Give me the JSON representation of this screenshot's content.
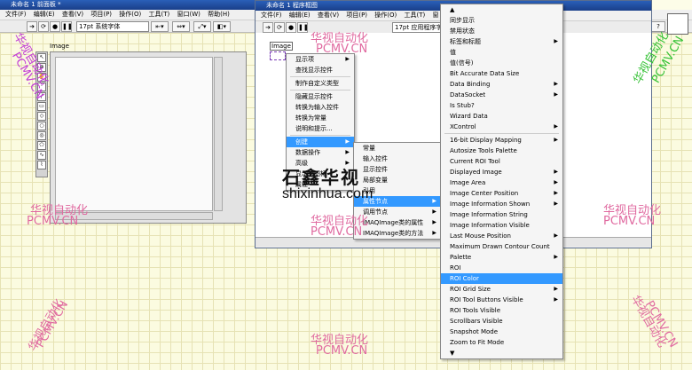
{
  "front_panel": {
    "title": "未命名 1 前面板 *",
    "menu": [
      "文件(F)",
      "编辑(E)",
      "查看(V)",
      "项目(P)",
      "操作(O)",
      "工具(T)",
      "窗口(W)",
      "帮助(H)"
    ],
    "font_dropdown": "17pt 系统字体",
    "image_label": "Image"
  },
  "block_diagram": {
    "title": "未命名 1 程序框图",
    "menu": [
      "文件(F)",
      "编辑(E)",
      "查看(V)",
      "项目(P)",
      "操作(O)",
      "工具(T)",
      "窗"
    ],
    "font_dropdown": "17pt 应用程序字",
    "node_label": "Image"
  },
  "context_menu": {
    "items": [
      {
        "label": "显示项",
        "arrow": true
      },
      {
        "label": "查找显示控件",
        "arrow": false
      },
      {
        "sep": true
      },
      {
        "label": "制作自定义类型",
        "arrow": false
      },
      {
        "sep": true
      },
      {
        "label": "隐藏显示控件",
        "arrow": false
      },
      {
        "label": "转换为输入控件",
        "arrow": false
      },
      {
        "label": "转换为常量",
        "arrow": false
      },
      {
        "label": "说明和提示...",
        "arrow": false
      },
      {
        "sep": true
      },
      {
        "label": "创建",
        "arrow": true,
        "highlight": true
      },
      {
        "label": "数据操作",
        "arrow": true
      },
      {
        "label": "高级",
        "arrow": true
      },
      {
        "label": "显示为图标",
        "arrow": false
      },
      {
        "label": "属性",
        "arrow": false
      }
    ]
  },
  "create_submenu": {
    "items": [
      {
        "label": "常量",
        "arrow": false
      },
      {
        "label": "输入控件",
        "arrow": false
      },
      {
        "label": "显示控件",
        "arrow": false
      },
      {
        "label": "局部变量",
        "arrow": false
      },
      {
        "label": "引用",
        "arrow": false
      },
      {
        "label": "属性节点",
        "arrow": true,
        "highlight": true
      },
      {
        "label": "调用节点",
        "arrow": true
      },
      {
        "label": "IMAQImage类的属性",
        "arrow": true
      },
      {
        "label": "IMAQImage类的方法",
        "arrow": true
      }
    ]
  },
  "property_menu": {
    "items": [
      {
        "label": "▲",
        "arrow": false
      },
      {
        "label": "同步显示",
        "arrow": false
      },
      {
        "label": "禁用状态",
        "arrow": false
      },
      {
        "label": "标签和标题",
        "arrow": true
      },
      {
        "label": "值",
        "arrow": false
      },
      {
        "label": "值(信号)",
        "arrow": false
      },
      {
        "label": "Bit Accurate Data Size",
        "arrow": false
      },
      {
        "label": "Data Binding",
        "arrow": true
      },
      {
        "label": "DataSocket",
        "arrow": true
      },
      {
        "label": "Is Stub?",
        "arrow": false
      },
      {
        "label": "Wizard Data",
        "arrow": false
      },
      {
        "label": "XControl",
        "arrow": true
      },
      {
        "sep": true
      },
      {
        "label": "16-bit Display Mapping",
        "arrow": true
      },
      {
        "label": "Autosize Tools Palette",
        "arrow": false
      },
      {
        "label": "Current ROI Tool",
        "arrow": false
      },
      {
        "label": "Displayed Image",
        "arrow": true
      },
      {
        "label": "Image Area",
        "arrow": true
      },
      {
        "label": "Image Center Position",
        "arrow": true
      },
      {
        "label": "Image Information Shown",
        "arrow": true
      },
      {
        "label": "Image Information String",
        "arrow": false
      },
      {
        "label": "Image Information Visible",
        "arrow": false
      },
      {
        "label": "Last Mouse Position",
        "arrow": true
      },
      {
        "label": "Maximum Drawn Contour Count",
        "arrow": false
      },
      {
        "label": "Palette",
        "arrow": true
      },
      {
        "label": "ROI",
        "arrow": false
      },
      {
        "label": "ROI Color",
        "arrow": false,
        "highlight": true
      },
      {
        "label": "ROI Grid Size",
        "arrow": true
      },
      {
        "label": "ROI Tool Buttons Visible",
        "arrow": true
      },
      {
        "label": "ROI Tools Visible",
        "arrow": false
      },
      {
        "label": "Scrollbars Visible",
        "arrow": false
      },
      {
        "label": "Snapshot Mode",
        "arrow": false
      },
      {
        "label": "Zoom to Fit Mode",
        "arrow": false
      },
      {
        "label": "▼",
        "arrow": false
      }
    ]
  },
  "watermarks": {
    "cn": "华视自动化",
    "url": "PCMV.CN",
    "site": "shixinhua.com",
    "logo": "石鑫华视"
  }
}
